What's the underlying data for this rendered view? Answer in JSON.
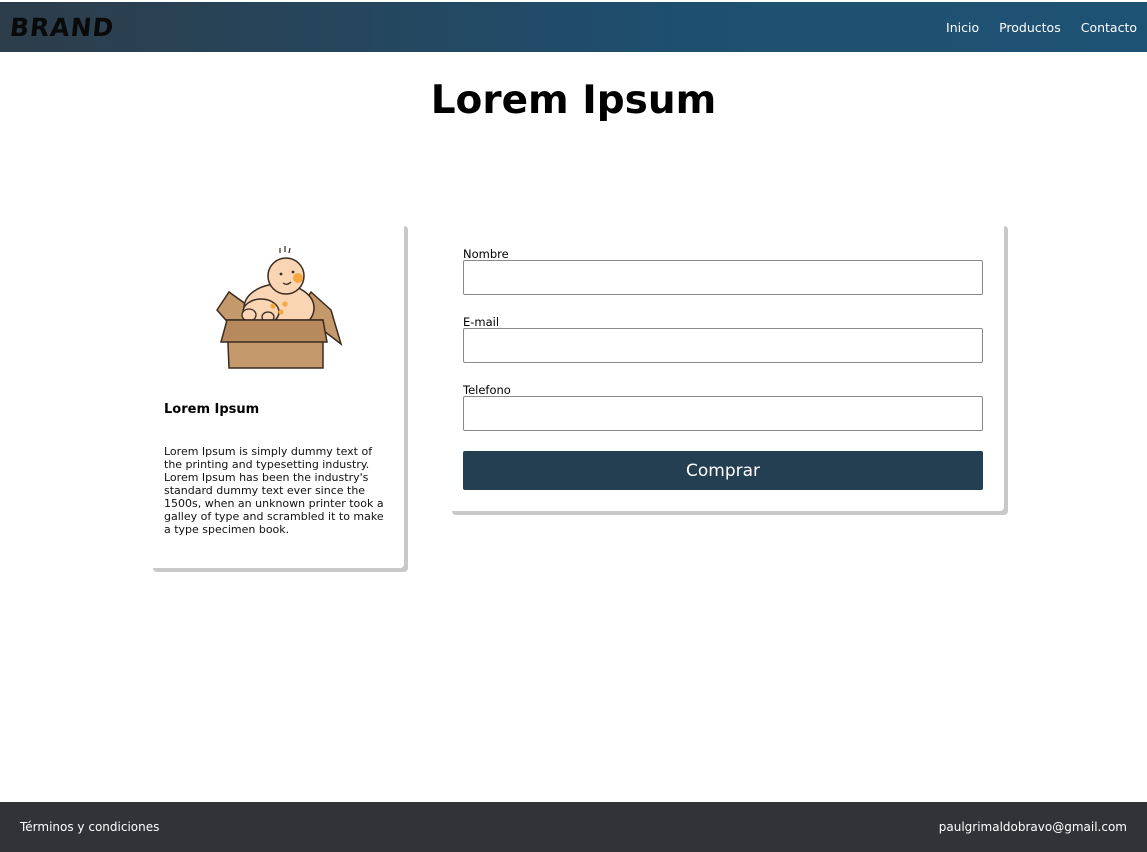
{
  "header": {
    "brand": "BRAND",
    "nav": [
      "Inicio",
      "Productos",
      "Contacto"
    ]
  },
  "main": {
    "title": "Lorem Ipsum"
  },
  "product_card": {
    "illustration_icon": "baby-in-box-illustration",
    "title": "Lorem Ipsum",
    "description": "Lorem Ipsum is simply dummy text of the printing and typesetting industry. Lorem Ipsum has been the industry's standard dummy text ever since the 1500s, when an unknown printer took a galley of type and scrambled it to make a type specimen book."
  },
  "form": {
    "fields": [
      {
        "label": "Nombre",
        "value": "",
        "placeholder": ""
      },
      {
        "label": "E-mail",
        "value": "",
        "placeholder": ""
      },
      {
        "label": "Telefono",
        "value": "",
        "placeholder": ""
      }
    ],
    "submit_label": "Comprar"
  },
  "footer": {
    "terms": "Términos y condiciones",
    "email": "paulgrimaldobravo@gmail.com"
  },
  "colors": {
    "navbar_start": "#2d3d4a",
    "navbar_end": "#1e5274",
    "button": "#243e52",
    "footer": "#323337"
  }
}
